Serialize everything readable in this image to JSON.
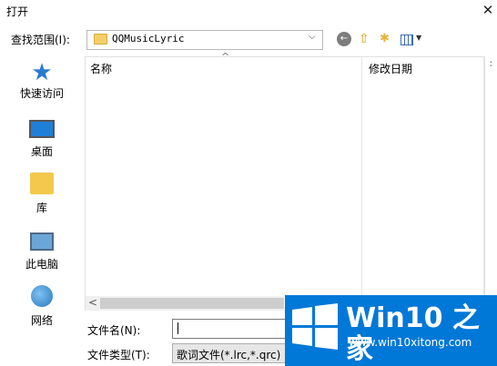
{
  "window": {
    "title": "打开",
    "close": "✕"
  },
  "toolbar": {
    "look_in_label": "查找范围(I):",
    "look_in_value": "QQMusicLyric",
    "dropdown": "⌵",
    "back": "←",
    "up": "⇧",
    "new_folder": "✱",
    "view_dd": "▼"
  },
  "places": [
    {
      "label": "快速访问",
      "icon": "star-icon"
    },
    {
      "label": "桌面",
      "icon": "desktop-icon"
    },
    {
      "label": "库",
      "icon": "library-icon"
    },
    {
      "label": "此电脑",
      "icon": "computer-icon"
    },
    {
      "label": "网络",
      "icon": "network-icon"
    }
  ],
  "file_list": {
    "columns": [
      "名称",
      "修改日期"
    ],
    "sort_indicator": "^",
    "extra_col": "∶",
    "scroll_left": "<"
  },
  "bottom": {
    "filename_label": "文件名(N):",
    "filename_value": "",
    "filetype_label": "文件类型(T):",
    "filetype_value": "歌词文件(*.lrc,*.qrc)"
  },
  "watermark": {
    "title": "Win10 之家",
    "url": "www.win10xitong.com"
  }
}
